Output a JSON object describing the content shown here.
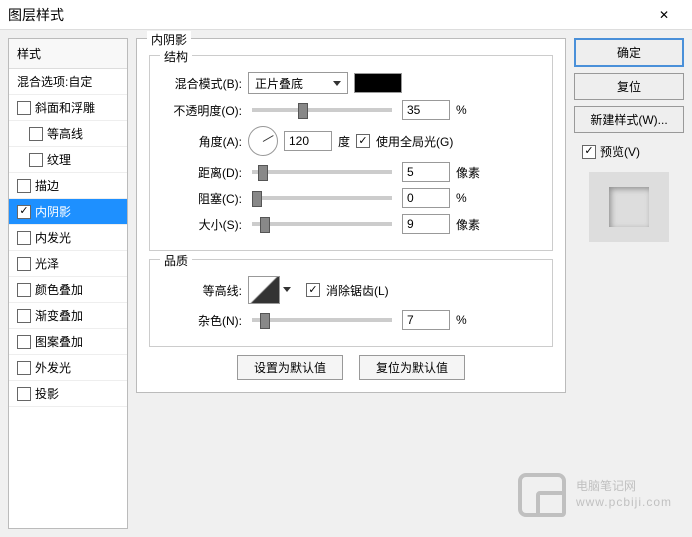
{
  "window": {
    "title": "图层样式"
  },
  "styles": {
    "header": "样式",
    "blend_options": "混合选项:自定",
    "items": [
      {
        "label": "斜面和浮雕",
        "checked": false
      },
      {
        "label": "等高线",
        "checked": false,
        "indent": true
      },
      {
        "label": "纹理",
        "checked": false,
        "indent": true
      },
      {
        "label": "描边",
        "checked": false
      },
      {
        "label": "内阴影",
        "checked": true,
        "selected": true
      },
      {
        "label": "内发光",
        "checked": false
      },
      {
        "label": "光泽",
        "checked": false
      },
      {
        "label": "颜色叠加",
        "checked": false
      },
      {
        "label": "渐变叠加",
        "checked": false
      },
      {
        "label": "图案叠加",
        "checked": false
      },
      {
        "label": "外发光",
        "checked": false
      },
      {
        "label": "投影",
        "checked": false
      }
    ]
  },
  "panel": {
    "title": "内阴影",
    "structure": {
      "legend": "结构",
      "blend_mode_label": "混合模式(B):",
      "blend_mode_value": "正片叠底",
      "opacity_label": "不透明度(O):",
      "opacity_value": "35",
      "opacity_unit": "%",
      "angle_label": "角度(A):",
      "angle_value": "120",
      "angle_unit": "度",
      "global_light_label": "使用全局光(G)",
      "distance_label": "距离(D):",
      "distance_value": "5",
      "distance_unit": "像素",
      "choke_label": "阻塞(C):",
      "choke_value": "0",
      "choke_unit": "%",
      "size_label": "大小(S):",
      "size_value": "9",
      "size_unit": "像素"
    },
    "quality": {
      "legend": "品质",
      "contour_label": "等高线:",
      "antialias_label": "消除锯齿(L)",
      "noise_label": "杂色(N):",
      "noise_value": "7",
      "noise_unit": "%"
    },
    "buttons": {
      "make_default": "设置为默认值",
      "reset_default": "复位为默认值"
    }
  },
  "right": {
    "ok": "确定",
    "cancel": "复位",
    "new_style": "新建样式(W)...",
    "preview_label": "预览(V)"
  },
  "watermark": {
    "line1": "电脑笔记网",
    "line2": "www.pcbiji.com"
  }
}
